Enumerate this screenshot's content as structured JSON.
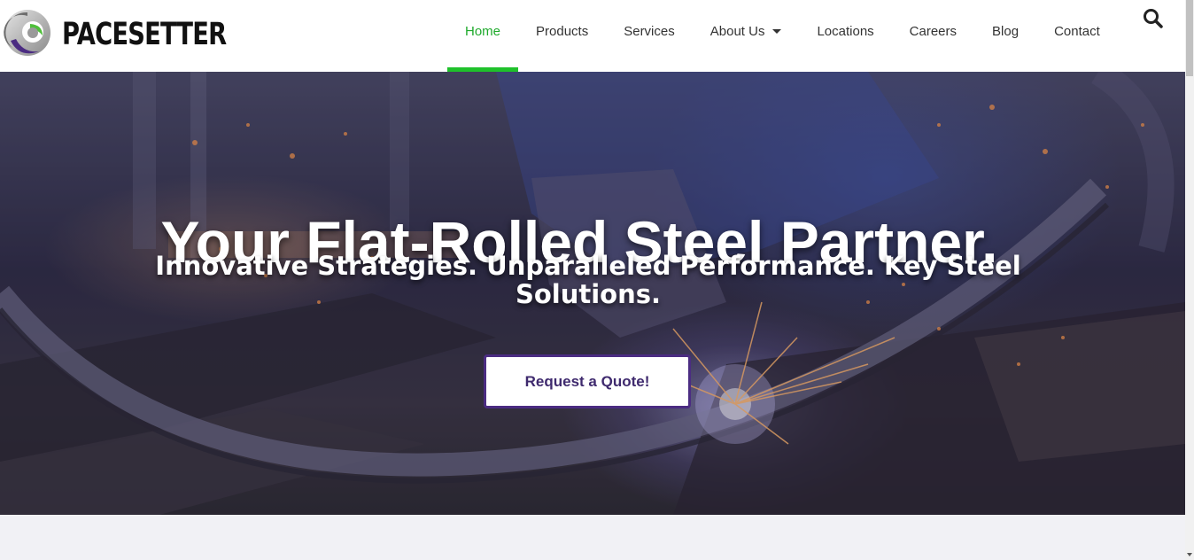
{
  "brand": {
    "name": "PACESETTER",
    "logo_icon": "pacesetter-swirl-logo"
  },
  "nav": {
    "items": [
      {
        "label": "Home",
        "active": true
      },
      {
        "label": "Products"
      },
      {
        "label": "Services"
      },
      {
        "label": "About Us",
        "has_dropdown": true
      },
      {
        "label": "Locations"
      },
      {
        "label": "Careers"
      },
      {
        "label": "Blog"
      },
      {
        "label": "Contact"
      }
    ],
    "search_icon": "search-icon"
  },
  "hero": {
    "title": "Your Flat-Rolled Steel Partner.",
    "subtitle": "Innovative Strategies. Unparalleled Performance. Key Steel Solutions.",
    "cta_label": "Request a Quote!"
  },
  "colors": {
    "accent_green": "#1fc12b",
    "cta_purple": "#4b2c82",
    "header_bg": "#ffffff",
    "section_bg": "#f1f1f5"
  }
}
